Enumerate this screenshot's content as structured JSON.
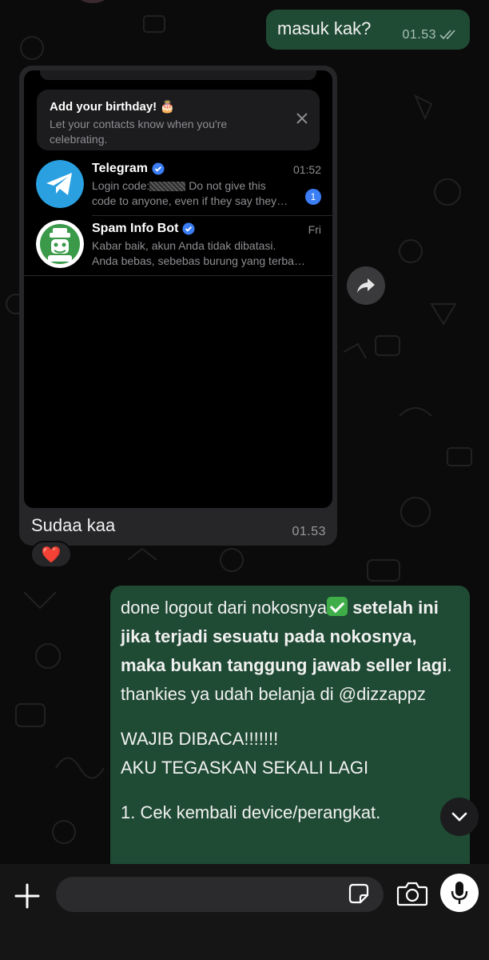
{
  "chat": {
    "messages": [
      {
        "direction": "outgoing",
        "text": "masuk kak?",
        "time": "01.53",
        "status": "read"
      },
      {
        "direction": "incoming",
        "caption": "Sudaa kaa",
        "time": "01.53",
        "reaction": "❤️",
        "attachment": {
          "type": "screenshot",
          "birthday_card": {
            "title": "Add your birthday! 🎂",
            "subtitle": "Let your contacts know when you're celebrating."
          },
          "chats": [
            {
              "name": "Telegram",
              "verified": true,
              "time": "01:52",
              "preview_line1_prefix": "Login code:",
              "preview_line1_suffix": " Do not give this",
              "preview_line2": "code to anyone, even if they say they…",
              "unread": "1"
            },
            {
              "name": "Spam Info Bot",
              "verified": true,
              "time": "Fri",
              "preview_line1": "Kabar baik, akun Anda tidak dibatasi.",
              "preview_line2": "Anda bebas, sebebas burung yang terba…"
            }
          ]
        }
      },
      {
        "direction": "outgoing",
        "text_p1_normal": "done logout dari nokosnya",
        "text_p1_emoji": "✅",
        "text_p1_bold": " setelah ini jika terjadi sesuatu pada nokosnya, maka bukan tanggung jawab seller lagi",
        "text_p1_tail": ". thankies ya udah belanja di @dizzappz",
        "text_p2_line1": "WAJIB DIBACA!!!!!!!",
        "text_p2_line2": "AKU TEGASKAN SEKALI LAGI",
        "text_p3": "1. Cek kembali device/perangkat."
      }
    ]
  },
  "colors": {
    "outgoing_bubble": "#1f4a34",
    "incoming_bubble": "#262628",
    "background": "#0b0b0b",
    "unread_badge": "#3b7df5",
    "verified": "#3b7df5"
  },
  "icons": {
    "forward": "forward-icon",
    "scroll_down": "chevron-down-icon",
    "attach": "plus-icon",
    "sticker": "sticker-icon",
    "camera": "camera-icon",
    "mic": "mic-icon"
  },
  "composer": {
    "placeholder": ""
  }
}
